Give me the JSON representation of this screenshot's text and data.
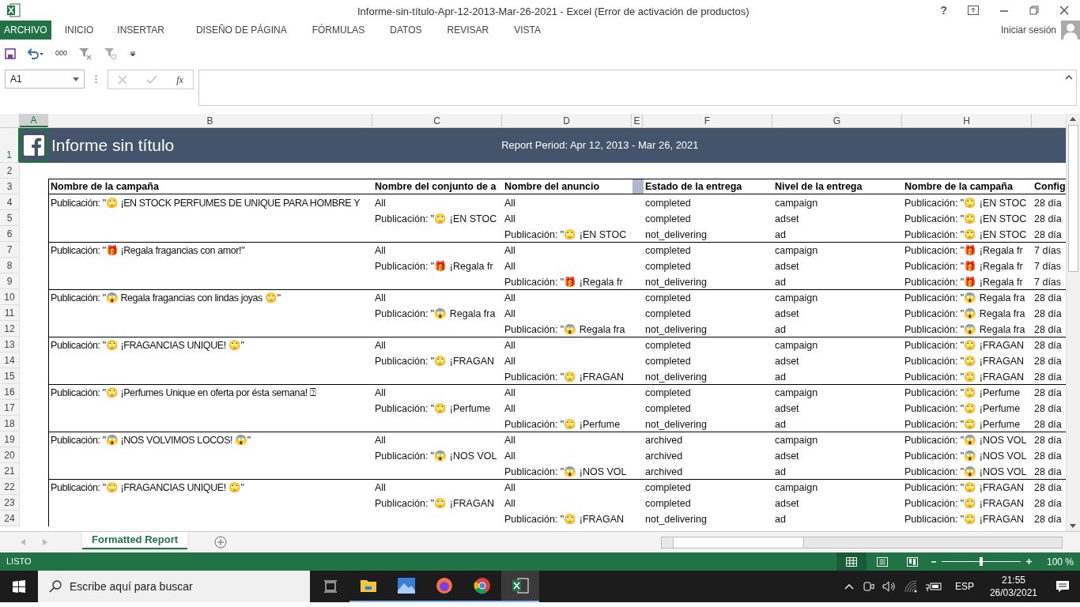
{
  "window": {
    "title": "Informe-sin-título-Apr-12-2013-Mar-26-2021 - Excel (Error de activación de productos)",
    "help": "?"
  },
  "ribbon_tabs": [
    {
      "label": "ARCHIVO",
      "selected": true
    },
    {
      "label": "INICIO",
      "selected": false
    },
    {
      "label": "INSERTAR",
      "selected": false
    },
    {
      "label": "DISEÑO DE PÁGINA",
      "selected": false
    },
    {
      "label": "FÓRMULAS",
      "selected": false
    },
    {
      "label": "DATOS",
      "selected": false
    },
    {
      "label": "REVISAR",
      "selected": false
    },
    {
      "label": "VISTA",
      "selected": false
    }
  ],
  "account": {
    "label": "Iniciar sesión"
  },
  "quick_access": {
    "number_format": "000"
  },
  "formula_bar": {
    "name_box": "A1",
    "fx": "fx"
  },
  "sheet": {
    "columns": [
      {
        "letter": "A",
        "selected": true
      },
      {
        "letter": "B",
        "selected": false
      },
      {
        "letter": "C",
        "selected": false
      },
      {
        "letter": "D",
        "selected": false
      },
      {
        "letter": "E",
        "selected": false
      },
      {
        "letter": "F",
        "selected": false
      },
      {
        "letter": "G",
        "selected": false
      },
      {
        "letter": "H",
        "selected": false
      }
    ],
    "title_row": {
      "num": "1",
      "selected": true,
      "title": "Informe sin título",
      "period": "Report Period: Apr 12, 2013 - Mar 26, 2021"
    },
    "blank_row": {
      "num": "2"
    },
    "header_row": {
      "num": "3",
      "b": "Nombre de la campaña",
      "c": "Nombre del conjunto de a",
      "d": "Nombre del anuncio",
      "f": "Estado de la entrega",
      "g": "Nivel de la entrega",
      "h": "Nombre de la campaña",
      "i": "Config"
    },
    "rows": [
      {
        "num": "4",
        "b": "Publicación: \"🙄 ¡EN STOCK PERFUMES DE UNIQUE PARA HOMBRE Y",
        "c": "All",
        "d": "All",
        "f": "completed",
        "g": "campaign",
        "h": "Publicación: \"🙄 ¡EN STOC",
        "i": "28 día"
      },
      {
        "num": "5",
        "c": "Publicación: \"🙄 ¡EN STOC",
        "d": "All",
        "f": "completed",
        "g": "adset",
        "h": "Publicación: \"🙄 ¡EN STOC",
        "i": "28 día"
      },
      {
        "num": "6",
        "d": "Publicación: \"🙄 ¡EN STOC",
        "f": "not_delivering",
        "g": "ad",
        "h": "Publicación: \"🙄 ¡EN STOC",
        "i": "28 día"
      },
      {
        "num": "7",
        "b": "Publicación: \"🎁 ¡Regala fragancias con amor!\"",
        "c": "All",
        "d": "All",
        "f": "completed",
        "g": "campaign",
        "h": "Publicación: \"🎁 ¡Regala fr",
        "i": "7 días"
      },
      {
        "num": "8",
        "c": "Publicación: \"🎁 ¡Regala fr",
        "d": "All",
        "f": "completed",
        "g": "adset",
        "h": "Publicación: \"🎁 ¡Regala fr",
        "i": "7 días"
      },
      {
        "num": "9",
        "d": "Publicación: \"🎁 ¡Regala fr",
        "f": "not_delivering",
        "g": "ad",
        "h": "Publicación: \"🎁 ¡Regala fr",
        "i": "7 días"
      },
      {
        "num": "10",
        "b": "Publicación: \"😱 Regala fragancias con lindas joyas 🙄\"",
        "c": "All",
        "d": "All",
        "f": "completed",
        "g": "campaign",
        "h": "Publicación: \"😱 Regala fra",
        "i": "28 día"
      },
      {
        "num": "11",
        "c": "Publicación: \"😱 Regala fra",
        "d": "All",
        "f": "completed",
        "g": "adset",
        "h": "Publicación: \"😱 Regala fra",
        "i": "28 día"
      },
      {
        "num": "12",
        "d": "Publicación: \"😱 Regala fra",
        "f": "not_delivering",
        "g": "ad",
        "h": "Publicación: \"😱 Regala fra",
        "i": "28 día"
      },
      {
        "num": "13",
        "b": "Publicación: \"🙄 ¡FRAGANCIAS UNIQUE! 🙄\"",
        "c": "All",
        "d": "All",
        "f": "completed",
        "g": "campaign",
        "h": "Publicación: \"🙄 ¡FRAGAN",
        "i": "28 día"
      },
      {
        "num": "14",
        "c": "Publicación: \"🙄 ¡FRAGAN",
        "d": "All",
        "f": "completed",
        "g": "adset",
        "h": "Publicación: \"🙄 ¡FRAGAN",
        "i": "28 día"
      },
      {
        "num": "15",
        "d": "Publicación: \"🙄 ¡FRAGAN",
        "f": "not_delivering",
        "g": "ad",
        "h": "Publicación: \"🙄 ¡FRAGAN",
        "i": "28 día"
      },
      {
        "num": "16",
        "b": "Publicación: \"🙄 ¡Perfumes Unique en oferta por ésta semana! ⍰",
        "c": "All",
        "d": "All",
        "f": "completed",
        "g": "campaign",
        "h": "Publicación: \"🙄 ¡Perfume",
        "i": "28 día"
      },
      {
        "num": "17",
        "c": "Publicación: \"🙄 ¡Perfume",
        "d": "All",
        "f": "completed",
        "g": "adset",
        "h": "Publicación: \"🙄 ¡Perfume",
        "i": "28 día"
      },
      {
        "num": "18",
        "d": "Publicación: \"🙄 ¡Perfume",
        "f": "not_delivering",
        "g": "ad",
        "h": "Publicación: \"🙄 ¡Perfume",
        "i": "28 día"
      },
      {
        "num": "19",
        "b": "Publicación: \"😱 ¡NOS VOLVIMOS LOCOS! 😱\"",
        "c": "All",
        "d": "All",
        "f": "archived",
        "g": "campaign",
        "h": "Publicación: \"😱 ¡NOS VOL",
        "i": "28 día"
      },
      {
        "num": "20",
        "c": "Publicación: \"😱 ¡NOS VOL",
        "d": "All",
        "f": "archived",
        "g": "adset",
        "h": "Publicación: \"😱 ¡NOS VOL",
        "i": "28 día"
      },
      {
        "num": "21",
        "d": "Publicación: \"😱 ¡NOS VOL",
        "f": "archived",
        "g": "ad",
        "h": "Publicación: \"😱 ¡NOS VOL",
        "i": "28 día"
      },
      {
        "num": "22",
        "b": "Publicación: \"🙄 ¡FRAGANCIAS UNIQUE! 🙄\"",
        "c": "All",
        "d": "All",
        "f": "completed",
        "g": "campaign",
        "h": "Publicación: \"🙄 ¡FRAGAN",
        "i": "28 día"
      },
      {
        "num": "23",
        "c": "Publicación: \"🙄 ¡FRAGAN",
        "d": "All",
        "f": "completed",
        "g": "adset",
        "h": "Publicación: \"🙄 ¡FRAGAN",
        "i": "28 día"
      },
      {
        "num": "24",
        "d": "Publicación: \"🙄 ¡FRAGAN",
        "f": "not_delivering",
        "g": "ad",
        "h": "Publicación: \"🙄 ¡FRAGAN",
        "i": "28 día"
      }
    ]
  },
  "sheet_tabs": [
    {
      "label": "Formatted Report",
      "selected": true
    }
  ],
  "status_bar": {
    "status": "LISTO",
    "zoom": "100 %",
    "zoom_slider": {
      "level": 0.5
    }
  },
  "taskbar": {
    "search_placeholder": "Escribe aquí para buscar",
    "language": "ESP",
    "time": "21:55",
    "date": "26/03/2021"
  }
}
